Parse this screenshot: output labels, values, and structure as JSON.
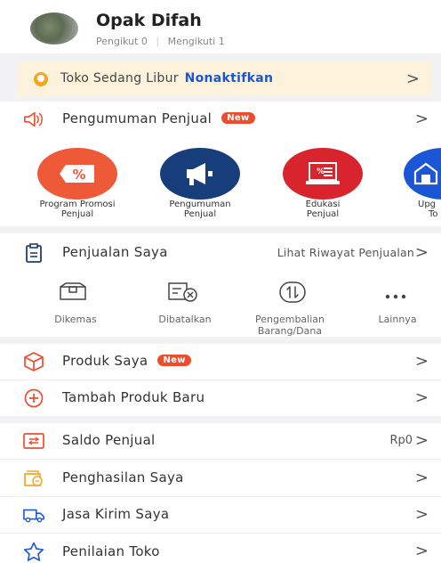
{
  "profile": {
    "name": "Opak Difah",
    "followers_label": "Pengikut 0",
    "following_label": "Mengikuti 1"
  },
  "holiday_banner": {
    "text": "Toko Sedang Libur",
    "action": "Nonaktifkan"
  },
  "announcement": {
    "label": "Pengumuman Penjual",
    "badge": "New"
  },
  "quick_links": [
    {
      "line1": "Program Promosi",
      "line2": "Penjual",
      "color": "#ee5a38",
      "icon": "discount-tag-icon"
    },
    {
      "line1": "Pengumuman",
      "line2": "Penjual",
      "color": "#173d7a",
      "icon": "megaphone-icon"
    },
    {
      "line1": "Edukasi",
      "line2": "Penjual",
      "color": "#d9232d",
      "icon": "laptop-icon"
    },
    {
      "line1": "Upg",
      "line2": "To",
      "color": "#1a56d6",
      "icon": "shop-icon"
    }
  ],
  "sales": {
    "title": "Penjualan Saya",
    "history_link": "Lihat Riwayat Penjualan"
  },
  "order_status": [
    {
      "line1": "Dikemas",
      "line2": "",
      "icon": "box-icon"
    },
    {
      "line1": "Dibatalkan",
      "line2": "",
      "icon": "cancelled-box-icon"
    },
    {
      "line1": "Pengembalian",
      "line2": "Barang/Dana",
      "icon": "return-icon"
    },
    {
      "line1": "Lainnya",
      "line2": "",
      "icon": "more-dots-icon"
    }
  ],
  "menu_product": [
    {
      "label": "Produk Saya",
      "badge": "New"
    },
    {
      "label": "Tambah Produk Baru",
      "badge": ""
    }
  ],
  "menu_finance": [
    {
      "label": "Saldo Penjual",
      "value": "Rp0"
    },
    {
      "label": "Penghasilan Saya",
      "value": ""
    },
    {
      "label": "Jasa Kirim Saya",
      "value": ""
    },
    {
      "label": "Penilaian Toko",
      "value": ""
    }
  ],
  "colors": {
    "accent": "#ee4d2d",
    "link": "#1a56d6",
    "banner_bg": "#fdf3dc",
    "banner_icon": "#f5a623"
  }
}
